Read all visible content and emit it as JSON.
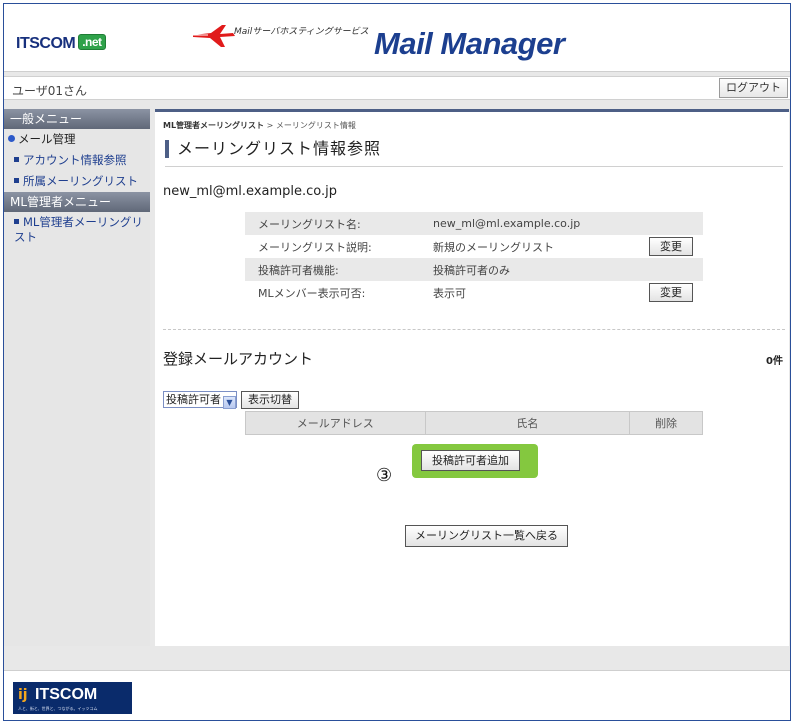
{
  "header": {
    "brand": "ITSCOM",
    "brand_net": ".net",
    "service_text": "Mailサーバホスティングサービス",
    "title": "Mail Manager"
  },
  "userbar": {
    "username": "ユーザ01さん",
    "logout": "ログアウト"
  },
  "sidebar": {
    "general_menu": "一般メニュー",
    "mail_admin": "メール管理",
    "account_info": "アカウント情報参照",
    "owned_lists": "所属メーリングリスト",
    "ml_admin_menu": "ML管理者メニュー",
    "ml_admin_lists": "ML管理者メーリングリスト"
  },
  "main": {
    "breadcrumb_parent": "ML管理者メーリングリスト",
    "breadcrumb_sep": ">",
    "breadcrumb_current": "メーリングリスト情報",
    "heading": "メーリングリスト情報参照",
    "address": "new_ml@ml.example.co.jp",
    "info_rows": [
      {
        "label": "メーリングリスト名:",
        "value": "new_ml@ml.example.co.jp",
        "button": ""
      },
      {
        "label": "メーリングリスト説明:",
        "value": "新規のメーリングリスト",
        "button": "変更"
      },
      {
        "label": "投稿許可者機能:",
        "value": "投稿許可者のみ",
        "button": ""
      },
      {
        "label": "MLメンバー表示可否:",
        "value": "表示可",
        "button": "変更"
      }
    ],
    "accounts_heading": "登録メールアカウント",
    "count": "0件",
    "filter_value": "投稿許可者",
    "toggle_button": "表示切替",
    "columns": [
      "メールアドレス",
      "氏名",
      "削除"
    ],
    "add_button": "投稿許可者追加",
    "circle_label": "③",
    "back_button": "メーリングリスト一覧へ戻る"
  },
  "footer": {
    "brand": "ITSCOM",
    "tagline": "人と、街と、世界と、つながる。イッツコム"
  }
}
